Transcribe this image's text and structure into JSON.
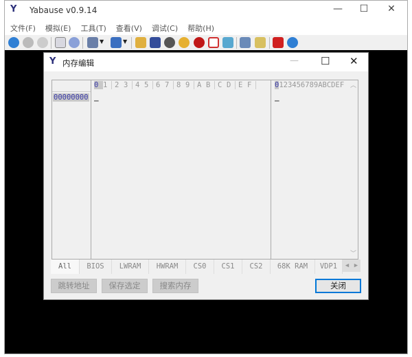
{
  "window": {
    "title": "Yabause v0.9.14",
    "minimize": "—",
    "maximize": "☐",
    "close": "✕"
  },
  "menu": [
    "文件(F)",
    "模拟(E)",
    "工具(T)",
    "查看(V)",
    "调试(C)",
    "帮助(H)"
  ],
  "toolbar": [
    "play-icon",
    "pause-icon",
    "reset-icon",
    "cd-image-icon",
    "disc-icon",
    "save-state-icon",
    "load-state-icon",
    "settings-icon",
    "display-icon",
    "audio-icon",
    "clock-icon",
    "cheat-icon",
    "fullscreen-icon",
    "screenshot-icon",
    "cartridge-icon",
    "backup-ram-icon",
    "power-icon",
    "info-icon"
  ],
  "colors": {
    "accent": "#0078d7",
    "address": "#3a3aa8"
  },
  "dialog": {
    "title": "内存编辑",
    "minimize": "—",
    "maximize": "☐",
    "close": "✕",
    "hex_header": [
      "0",
      "1",
      "2",
      "3",
      "4",
      "5",
      "6",
      "7",
      "8",
      "9",
      "A",
      "B",
      "C",
      "D",
      "E",
      "F"
    ],
    "ascii_header_first": "0",
    "ascii_header_rest": "123456789ABCDEF",
    "address": "00000000",
    "cursor": "_",
    "tabs": [
      "All",
      "BIOS",
      "LWRAM",
      "HWRAM",
      "CS0",
      "CS1",
      "CS2",
      "68K RAM",
      "VDP1"
    ],
    "buttons": {
      "goto": "跳转地址",
      "save": "保存选定",
      "search": "搜索内存",
      "close": "关闭"
    }
  }
}
